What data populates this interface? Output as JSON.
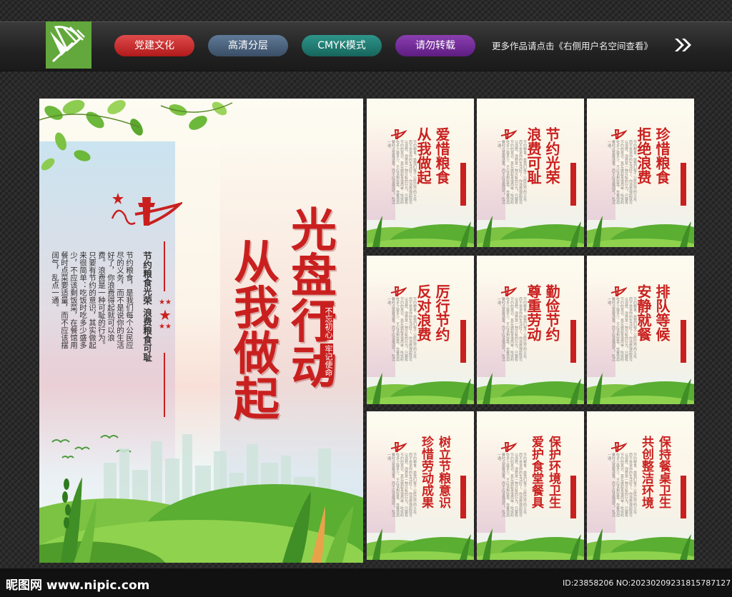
{
  "top_bar": {
    "tags": [
      "党建文化",
      "高清分层",
      "CMYK模式",
      "请勿转载"
    ],
    "more_text": "更多作品请点击《右侧用户名空间查看》"
  },
  "main_poster": {
    "title_line1": "光盘行动",
    "title_line2": "从我做起",
    "seal_1": "不忘初心",
    "seal_2": "牢记使命",
    "subtitle": "节约粮食光荣 浪费粮食可耻",
    "body": "节约粮食，是我们每个公民应尽的义务，而不是说你的生活好了，你浪费得起就可以浪费。浪费是一种可耻的行为。只要有节约的意识，其实做起来很简单：吃饭时吃多少盛多少，不应该剩饭菜，在餐馆用餐时点菜要适量，而不应该摆阔气，乱点一通。",
    "logo_text": "中国梦"
  },
  "small_posters": [
    {
      "line1": "爱惜粮食",
      "line2": "从我做起"
    },
    {
      "line1": "节约光荣",
      "line2": "浪费可耻"
    },
    {
      "line1": "珍惜粮食",
      "line2": "拒绝浪费"
    },
    {
      "line1": "厉行节约",
      "line2": "反对浪费"
    },
    {
      "line1": "勤俭节约",
      "line2": "尊重劳动"
    },
    {
      "line1": "排队等候",
      "line2": "安静就餐"
    },
    {
      "line1": "树立节粮意识",
      "line2": "珍惜劳动成果"
    },
    {
      "line1": "保护环境卫生",
      "line2": "爱护食堂餐具"
    },
    {
      "line1": "保持餐桌卫生",
      "line2": "共创整洁环境"
    }
  ],
  "footer": {
    "site": "昵图网 www.nipic.com",
    "id_text": "ID:23858206 NO:20230209231815787127"
  },
  "colors": {
    "accent_red": "#c9201f",
    "brand_green": "#62a83c"
  }
}
